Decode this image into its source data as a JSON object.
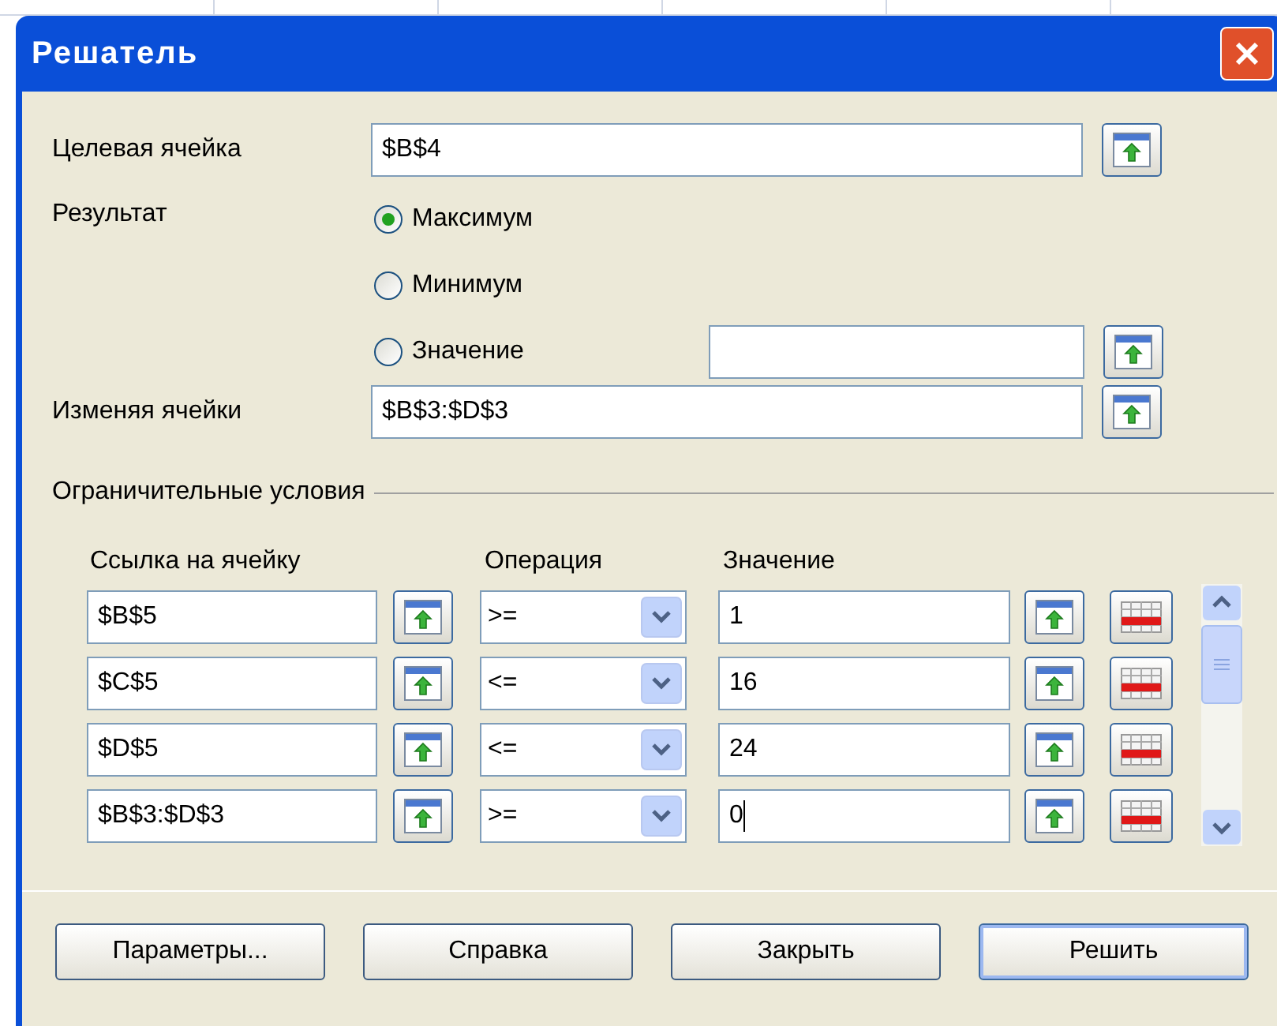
{
  "window": {
    "title": "Решатель"
  },
  "target_cell": {
    "label": "Целевая ячейка",
    "value": "$B$4"
  },
  "result": {
    "label": "Результат",
    "options": [
      {
        "label": "Максимум",
        "selected": true
      },
      {
        "label": "Минимум",
        "selected": false
      },
      {
        "label": "Значение",
        "selected": false
      }
    ]
  },
  "changing_cells": {
    "label": "Изменяя ячейки",
    "value": "$B$3:$D$3"
  },
  "constraints": {
    "title": "Ограничительные условия",
    "columns": [
      "Ссылка на ячейку",
      "Операция",
      "Значение"
    ],
    "rows": [
      {
        "cell": "$B$5",
        "operator": ">=",
        "value": "1"
      },
      {
        "cell": "$C$5",
        "operator": "<=",
        "value": "16"
      },
      {
        "cell": "$D$5",
        "operator": "<=",
        "value": "24"
      },
      {
        "cell": "$B$3:$D$3",
        "operator": ">=",
        "value": "0"
      }
    ]
  },
  "buttons": [
    {
      "label": "Параметры...",
      "default": false
    },
    {
      "label": "Справка",
      "default": false
    },
    {
      "label": "Закрыть",
      "default": false
    },
    {
      "label": "Решить",
      "default": true
    }
  ]
}
